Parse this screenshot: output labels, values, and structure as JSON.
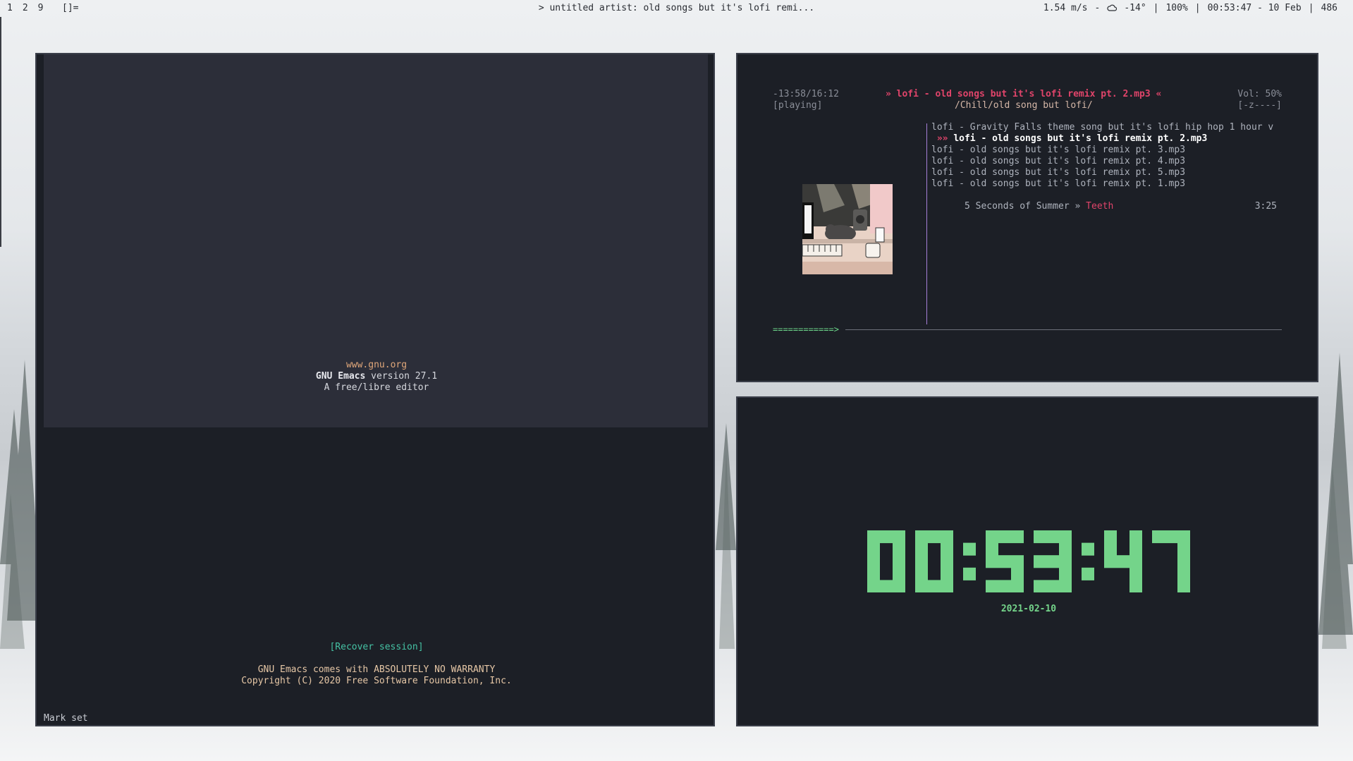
{
  "topbar": {
    "workspaces": [
      "1",
      "2",
      "9"
    ],
    "layout": "[]=",
    "window_title": "> untitled artist: old songs but it's lofi remi...",
    "wind": "1.54 m/s",
    "weather_sep": "-",
    "temperature": "-14°",
    "battery": "100%",
    "datetime": "00:53:47 - 10 Feb",
    "extra": "486",
    "separator": "|"
  },
  "emacs": {
    "url": "www.gnu.org",
    "name": "GNU Emacs",
    "version": "version 27.1",
    "tagline": "A free/libre editor",
    "recover": "[Recover session]",
    "warranty": "GNU Emacs comes with ABSOLUTELY NO WARRANTY",
    "copyright": "Copyright (C) 2020 Free Software Foundation, Inc.",
    "minibuffer": "Mark set"
  },
  "ncmpcpp": {
    "time": "-13:58/16:12",
    "state": "[playing]",
    "now_playing": "» lofi - old songs but it's lofi remix pt. 2.mp3 «",
    "directory": "/Chill/old song but lofi/",
    "volume": "Vol: 50%",
    "volume_bar": "[-z----]",
    "progress_bar": "============>",
    "playlist": [
      {
        "text": "lofi - Gravity Falls theme song but it's lofi hip hop 1 hour v"
      },
      {
        "arrow": "»»",
        "text": "lofi - old songs but it's lofi remix pt. 2.mp3"
      },
      {
        "text": "lofi - old songs but it's lofi remix pt. 3.mp3"
      },
      {
        "text": "lofi - old songs but it's lofi remix pt. 4.mp3"
      },
      {
        "text": "lofi - old songs but it's lofi remix pt. 5.mp3"
      },
      {
        "text": "lofi - old songs but it's lofi remix pt. 1.mp3"
      }
    ],
    "last_item": {
      "artist": "5 Seconds of Summer",
      "sep": "»",
      "title": "Teeth",
      "duration": "3:25"
    }
  },
  "clock": {
    "time": "00:53:47",
    "date": "2021-02-10",
    "color": "#74d48a"
  }
}
